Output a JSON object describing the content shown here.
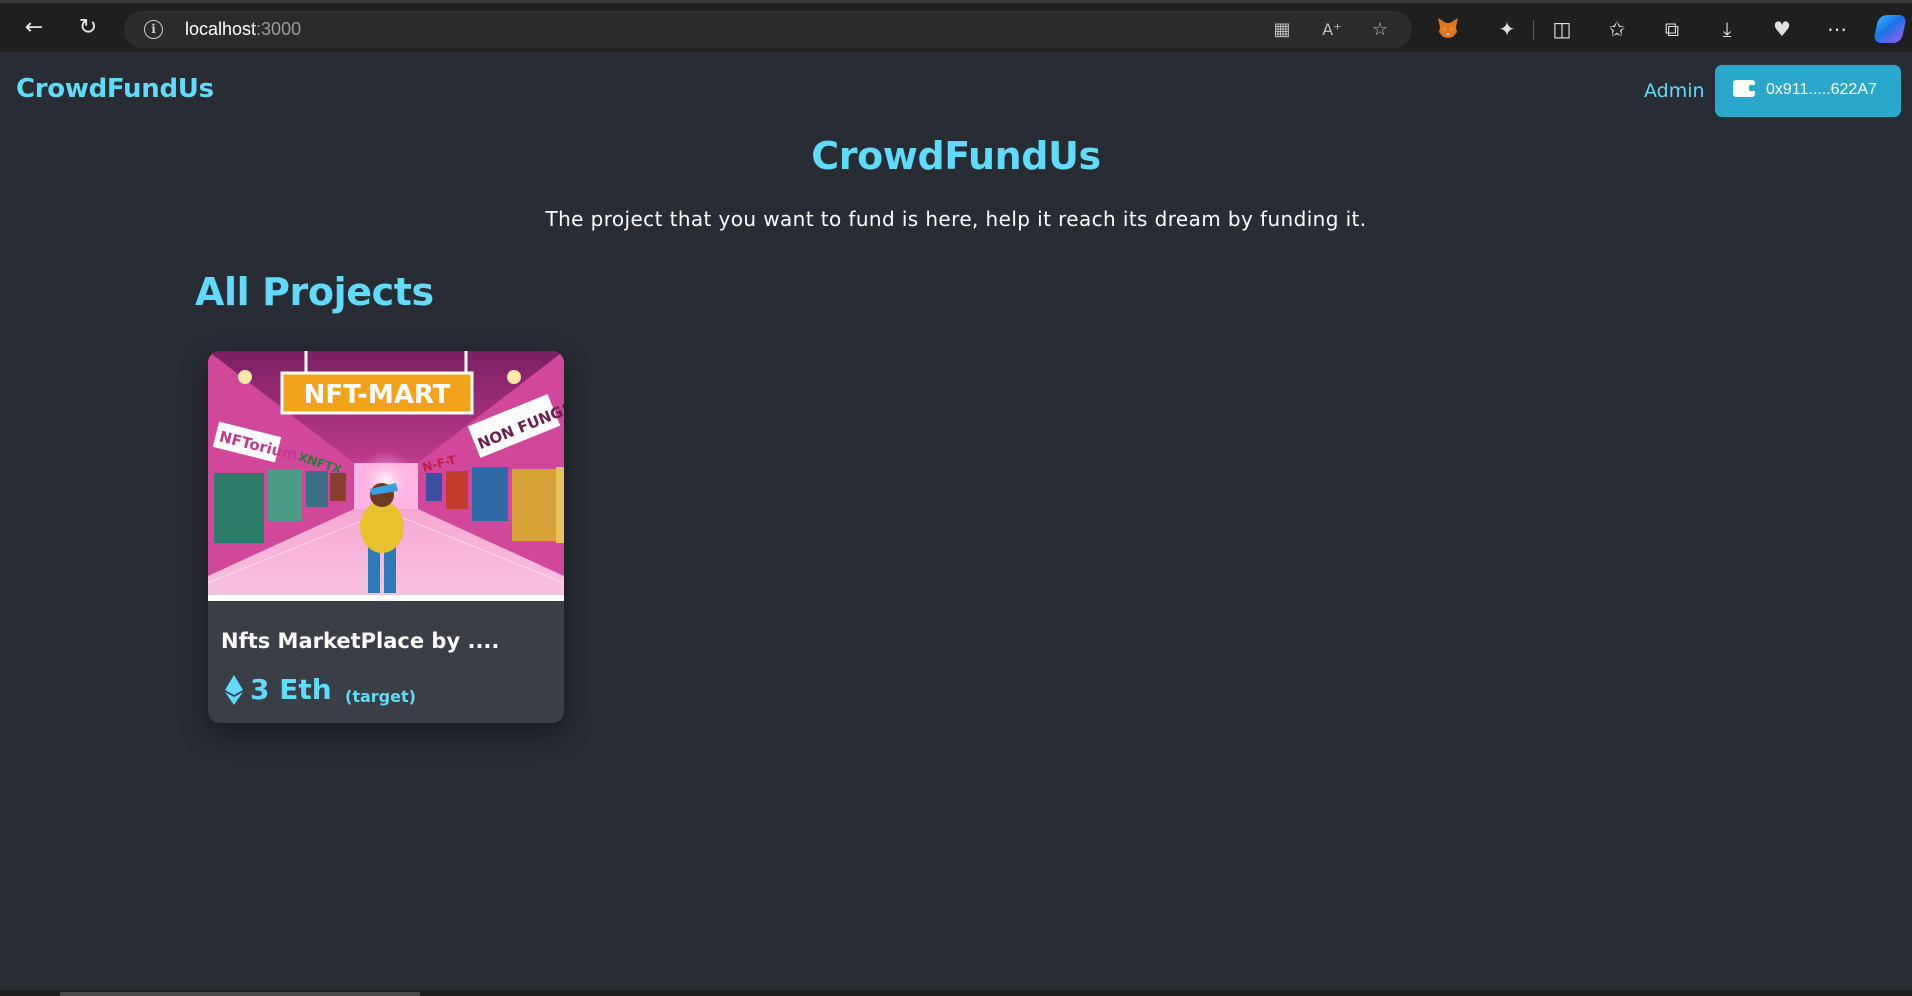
{
  "browser": {
    "url_host": "localhost",
    "url_port": ":3000",
    "icons": [
      "back-icon",
      "refresh-icon",
      "info-icon",
      "app-available-icon",
      "read-aloud-icon",
      "favorite-star-icon",
      "metamask-icon",
      "extensions-icon",
      "split-screen-icon",
      "favorites-icon",
      "collections-icon",
      "downloads-icon",
      "browser-essentials-icon",
      "more-icon",
      "copilot-icon"
    ]
  },
  "navbar": {
    "brand": "CrowdFundUs",
    "admin_label": "Admin",
    "wallet_address": "0x911.....622A7"
  },
  "hero": {
    "title": "CrowdFundUs",
    "subtitle": "The project that you want to fund is here, help it reach its dream by funding it."
  },
  "projects": {
    "heading": "All Projects",
    "items": [
      {
        "title": "Nfts MarketPlace by ....",
        "target_amount": "3 Eth",
        "target_label": "(target)",
        "image_sign": "NFT-MART",
        "image_wall_left": "NFTorium",
        "image_wall_right": "NON FUNG!",
        "image_wall_mid": "N-F-T",
        "image_shelf": "XNFTX"
      }
    ]
  },
  "colors": {
    "accent": "#61dafb",
    "background": "#282c34",
    "card": "#3a3e47",
    "wallet_button": "#2aa8cc"
  }
}
